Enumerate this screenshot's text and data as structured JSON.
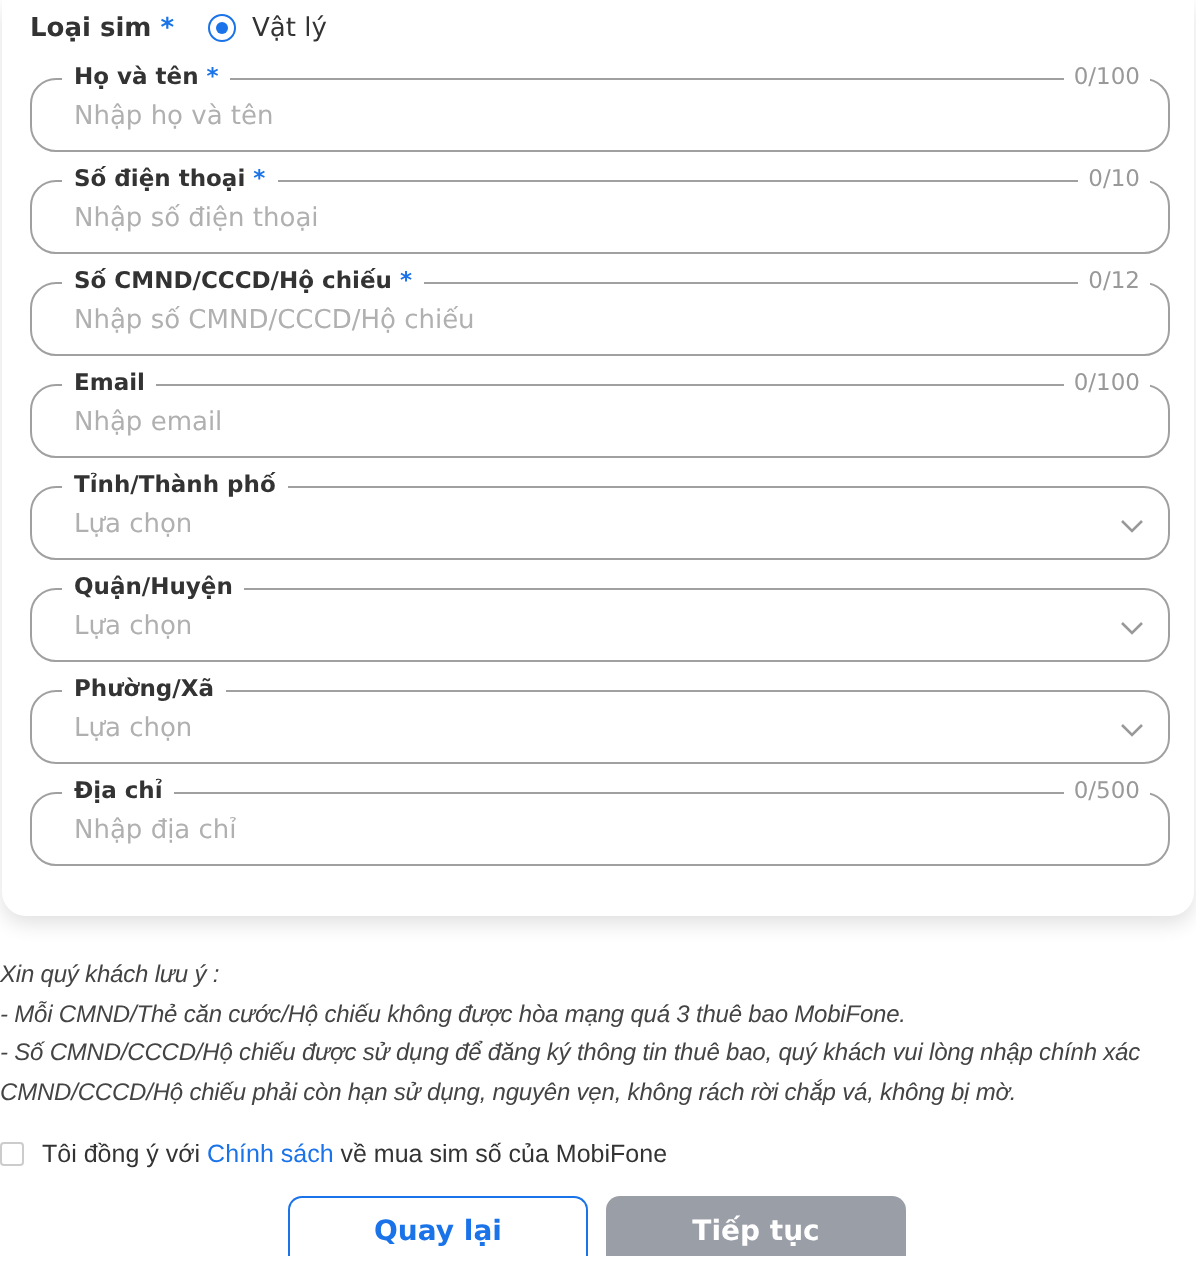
{
  "sim_type": {
    "label": "Loại sim",
    "required_mark": "*",
    "options": [
      {
        "label": "Vật lý",
        "selected": true
      }
    ]
  },
  "fields": [
    {
      "kind": "text",
      "label": "Họ và tên",
      "required_mark": "*",
      "counter": "0/100",
      "placeholder": "Nhập họ và tên"
    },
    {
      "kind": "text",
      "label": "Số điện thoại",
      "required_mark": "*",
      "counter": "0/10",
      "placeholder": "Nhập số điện thoại"
    },
    {
      "kind": "text",
      "label": "Số CMND/CCCD/Hộ chiếu",
      "required_mark": "*",
      "counter": "0/12",
      "placeholder": "Nhập số CMND/CCCD/Hộ chiếu"
    },
    {
      "kind": "text",
      "label": "Email",
      "counter": "0/100",
      "placeholder": "Nhập email"
    },
    {
      "kind": "select",
      "label": "Tỉnh/Thành phố",
      "placeholder": "Lựa chọn"
    },
    {
      "kind": "select",
      "label": "Quận/Huyện",
      "placeholder": "Lựa chọn"
    },
    {
      "kind": "select",
      "label": "Phường/Xã",
      "placeholder": "Lựa chọn"
    },
    {
      "kind": "text",
      "label": "Địa chỉ",
      "counter": "0/500",
      "placeholder": "Nhập địa chỉ"
    }
  ],
  "notes": [
    "Xin quý khách lưu ý :",
    "- Mỗi CMND/Thẻ căn cước/Hộ chiếu không được hòa mạng quá 3 thuê bao MobiFone.",
    "- Số CMND/CCCD/Hộ chiếu được sử dụng để đăng ký thông tin thuê bao, quý khách vui lòng nhập chính xác",
    "CMND/CCCD/Hộ chiếu phải còn hạn sử dụng, nguyên vẹn, không rách rời chắp vá, không bị mờ."
  ],
  "agreement": {
    "checked": false,
    "before": "Tôi đồng ý với",
    "link": "Chính sách",
    "after": "về mua sim số của MobiFone"
  },
  "buttons": [
    {
      "label": "Quay lại",
      "kind": "secondary",
      "disabled": false
    },
    {
      "label": "Tiếp tục",
      "kind": "primary",
      "disabled": true
    }
  ]
}
